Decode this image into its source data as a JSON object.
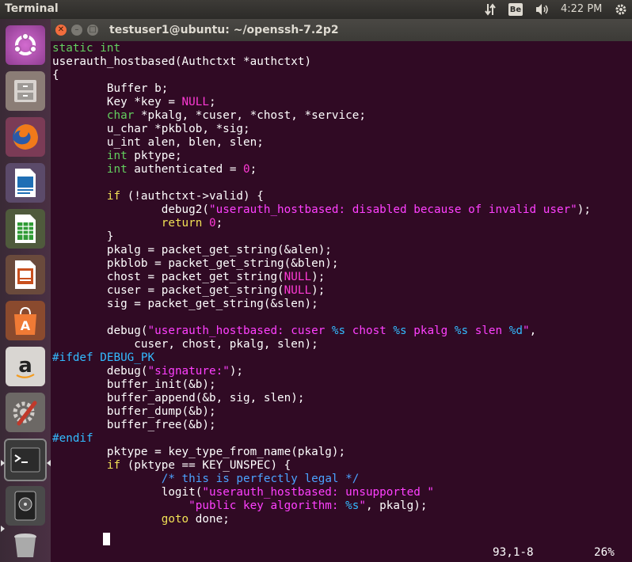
{
  "panel": {
    "app_name": "Terminal",
    "keyboard_layout": "Be",
    "time": "4:22 PM"
  },
  "launcher": {
    "items": [
      "Ubuntu Dash",
      "Files",
      "Firefox",
      "LibreOffice Writer",
      "LibreOffice Calc",
      "LibreOffice Impress",
      "Ubuntu Software",
      "Amazon",
      "System Settings",
      "Terminal",
      "Disks",
      "Trash"
    ]
  },
  "window": {
    "title": "testuser1@ubuntu: ~/openssh-7.2p2"
  },
  "code": {
    "l1": {
      "a": "static",
      "b": " ",
      "c": "int"
    },
    "l2": "userauth_hostbased(Authctxt *authctxt)",
    "l3": "{",
    "l4": "        Buffer b;",
    "l5": {
      "a": "        Key *key = ",
      "b": "NULL",
      "c": ";"
    },
    "l6": {
      "a": "        ",
      "b": "char",
      "c": " *pkalg, *cuser, *chost, *service;"
    },
    "l7": "        u_char *pkblob, *sig;",
    "l8": "        u_int alen, blen, slen;",
    "l9": {
      "a": "        ",
      "b": "int",
      "c": " pktype;"
    },
    "l10": {
      "a": "        ",
      "b": "int",
      "c": " authenticated = ",
      "d": "0",
      "e": ";"
    },
    "l11": {
      "a": "        ",
      "b": "if",
      "c": " (!authctxt->valid) {"
    },
    "l12": {
      "a": "                debug2(",
      "b": "\"userauth_hostbased: disabled because of invalid user\"",
      "c": ");"
    },
    "l13": {
      "a": "                ",
      "b": "return",
      "c": " ",
      "d": "0",
      "e": ";"
    },
    "l14": "        }",
    "l15": "        pkalg = packet_get_string(&alen);",
    "l16": "        pkblob = packet_get_string(&blen);",
    "l17": {
      "a": "        chost = packet_get_string(",
      "b": "NULL",
      "c": ");"
    },
    "l18": {
      "a": "        cuser = packet_get_string(",
      "b": "NULL",
      "c": ");"
    },
    "l19": "        sig = packet_get_string(&slen);",
    "l20": {
      "a": "        debug(",
      "b": "\"userauth_hostbased: cuser ",
      "c": "%s",
      "d": " chost ",
      "e": "%s",
      "f": " pkalg ",
      "g": "%s",
      "h": " slen ",
      "i": "%d",
      "j": "\"",
      "k": ","
    },
    "l21": "            cuser, chost, pkalg, slen);",
    "l22": "#ifdef DEBUG_PK",
    "l23": {
      "a": "        debug(",
      "b": "\"signature:\"",
      "c": ");"
    },
    "l24": "        buffer_init(&b);",
    "l25": "        buffer_append(&b, sig, slen);",
    "l26": "        buffer_dump(&b);",
    "l27": "        buffer_free(&b);",
    "l28": "#endif",
    "l29": "        pktype = key_type_from_name(pkalg);",
    "l30": {
      "a": "        ",
      "b": "if",
      "c": " (pktype == KEY_UNSPEC) {"
    },
    "l31": {
      "a": "                ",
      "b": "/* this is perfectly legal */"
    },
    "l32": {
      "a": "                logit(",
      "b": "\"userauth_hostbased: unsupported \""
    },
    "l33": {
      "a": "                    ",
      "b": "\"public key algorithm: ",
      "c": "%s",
      "d": "\"",
      "e": ", pkalg);"
    },
    "l34": {
      "a": "                ",
      "b": "goto",
      "c": " done;"
    }
  },
  "status": {
    "position": "93,1-8",
    "percent": "26%"
  }
}
